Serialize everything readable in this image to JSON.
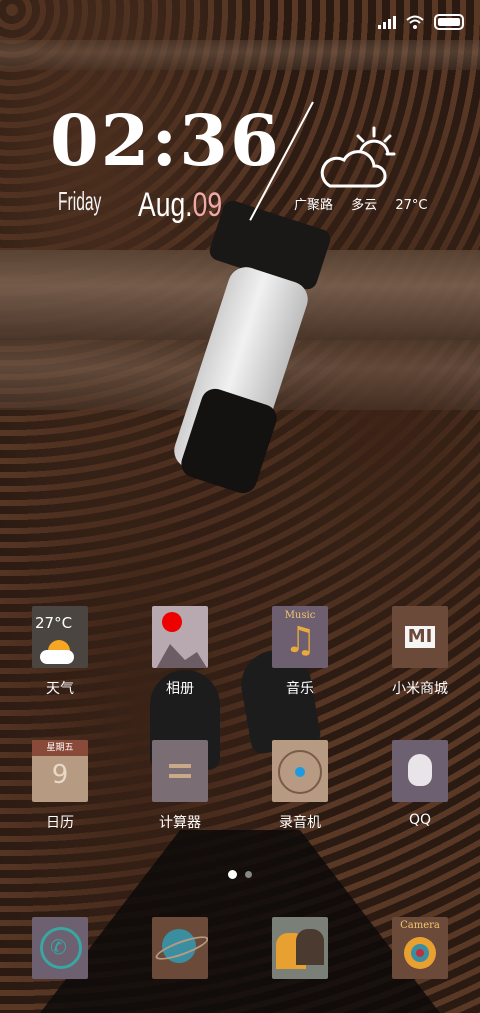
{
  "status_bar": {
    "signal_icon": "signal-bars-icon",
    "wifi_icon": "wifi-icon",
    "battery_icon": "battery-icon"
  },
  "widget": {
    "time": "02:36",
    "day": "Friday",
    "month": "Aug.",
    "date": "09",
    "weather_icon": "partly-cloudy-icon",
    "location": "广聚路",
    "condition": "多云",
    "temperature": "27°C"
  },
  "apps_row1": [
    {
      "label": "天气",
      "badge": "27°C",
      "icon": "weather-app-icon"
    },
    {
      "label": "相册",
      "icon": "gallery-icon"
    },
    {
      "label": "音乐",
      "badge": "Music",
      "icon": "music-icon"
    },
    {
      "label": "小米商城",
      "badge": "MI",
      "icon": "mi-store-icon"
    }
  ],
  "apps_row2": [
    {
      "label": "日历",
      "header": "星期五",
      "day": "9",
      "icon": "calendar-icon"
    },
    {
      "label": "计算器",
      "icon": "calculator-icon"
    },
    {
      "label": "录音机",
      "icon": "recorder-icon"
    },
    {
      "label": "QQ",
      "icon": "qq-icon"
    }
  ],
  "dock": [
    {
      "icon": "phone-icon"
    },
    {
      "icon": "browser-icon"
    },
    {
      "icon": "messages-icon"
    },
    {
      "badge": "Camera",
      "icon": "camera-icon"
    }
  ],
  "page_indicator": {
    "current": 1,
    "total": 2
  },
  "colors": {
    "date_accent": "#f0a7a7"
  }
}
